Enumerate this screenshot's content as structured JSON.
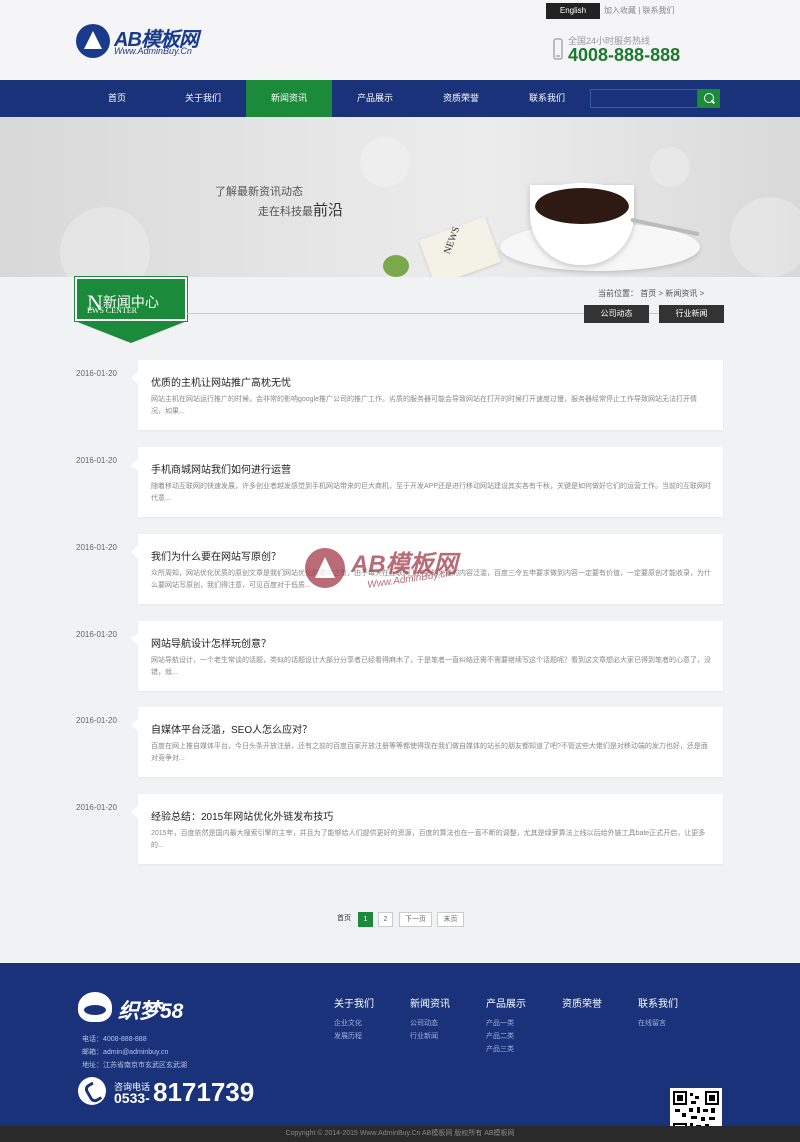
{
  "header": {
    "logo_text": "AB模板网",
    "logo_sub": "Www.AdminBuy.Cn",
    "lang_button": "English",
    "top_links": "加入收藏 | 联系我们",
    "hotline_label": "全国24小时服务热线",
    "hotline_number": "4008-888-888"
  },
  "nav": {
    "items": [
      {
        "label": "首页"
      },
      {
        "label": "关于我们"
      },
      {
        "label": "新闻资讯"
      },
      {
        "label": "产品展示"
      },
      {
        "label": "资质荣誉"
      },
      {
        "label": "联系我们"
      }
    ],
    "active_index": 2,
    "search_placeholder": ""
  },
  "banner": {
    "line1": "了解最新资讯动态",
    "line2_prefix": "走在科技最",
    "line2_emphasis": "前沿",
    "newspaper_text": "NEWS"
  },
  "section": {
    "title_initial": "N",
    "title": "新闻中心",
    "subtitle": "EWS CENTER",
    "breadcrumb": "当前位置： 首页 > 新闻资讯 >",
    "categories": [
      "公司动态",
      "行业新闻"
    ]
  },
  "news": [
    {
      "date": "2016-01-20",
      "title": "优质的主机让网站推广高枕无忧",
      "desc": "网站主机在网站运行推广的时候，会非常的影响google推广公司的推广工作。劣质的服务器可能会导致网站在打开的时候打开速度过慢，服务器经常停止工作导致网站无法打开情况，如果..."
    },
    {
      "date": "2016-01-20",
      "title": "手机商城网站我们如何进行运营",
      "desc": "随着移动互联网的快速发展，许多创业者越发感觉到手机网站带来的巨大商机，至于开发APP还是进行移动网站建设其实各有千秋，关键是如何做好它们的运营工作。当前的互联网时代意..."
    },
    {
      "date": "2016-01-20",
      "title": "我们为什么要在网站写原创？",
      "desc": "众所周知，网站优化优质的原创文章是我们网站优化的重中之重，由于每天在互联网上产生的大量的内容泛滥，百度三令五申要求做到内容一定要有价值，一定要原创才能收录，为什么要网站写原创，我们得注意，可见百度对于低质..."
    },
    {
      "date": "2016-01-20",
      "title": "网站导航设计怎样玩创意？",
      "desc": "网站导航设计，一个老生常谈的话题，类似的话题设计大部分分享者已经看得麻木了，于是笔者一直纠结还需不需要继续写这个话题呢？看到这文章想必大家已得到笔者的心意了，没错，就..."
    },
    {
      "date": "2016-01-20",
      "title": "自媒体平台泛滥，SEO人怎么应对？",
      "desc": "百度在网上推自媒体平台，今日头条开放注册，还有之前的百度百家开放注册等等都使得现在我们做自媒体的站长的朋友都知道了吧?不管这些大佬们是对移动端的发力也好，还是面对竞争对..."
    },
    {
      "date": "2016-01-20",
      "title": "经验总结：2015年网站优化外链发布技巧",
      "desc": "2015年，百度依然是国内最大搜索引擎的主宰，并且为了能够给人们提供更好的资源，百度的算法也在一直不断的调整，尤其是绿萝算法上线以后给外链工具bate正式开启，让更多的..."
    }
  ],
  "watermark": {
    "text": "AB模板网",
    "sub": "Www.AdminBuy.cn"
  },
  "pagination": {
    "label": "首页",
    "pages": [
      "1",
      "2"
    ],
    "current": "1",
    "next": "下一页",
    "last": "末页"
  },
  "footer": {
    "logo_text": "织梦58",
    "contacts": [
      "电话：4008-888-888",
      "邮箱：admin@adminbuy.cn",
      "地址：江苏省南京市玄武区玄武湖"
    ],
    "phone_label": "咨询电话",
    "phone_area": "0533-",
    "phone_number": "8171739",
    "columns": [
      {
        "title": "关于我们",
        "links": [
          "企业文化",
          "发展历程"
        ]
      },
      {
        "title": "新闻资讯",
        "links": [
          "公司动态",
          "行业新闻"
        ]
      },
      {
        "title": "产品展示",
        "links": [
          "产品一类",
          "产品二类",
          "产品三类"
        ]
      },
      {
        "title": "资质荣誉",
        "links": []
      },
      {
        "title": "联系我们",
        "links": [
          "在线留言"
        ]
      }
    ],
    "copyright": "Copyright © 2014-2015 Www.AdminBuy.Cn AB模板网 版权所有   AB模板网"
  },
  "colors": {
    "primary": "#1a327a",
    "accent": "#1b8a3a"
  }
}
